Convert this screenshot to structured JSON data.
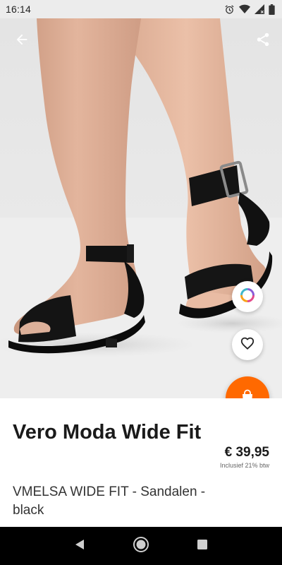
{
  "status_bar": {
    "time": "16:14",
    "icons": [
      "alarm-icon",
      "wifi-icon",
      "signal-icon",
      "battery-icon"
    ]
  },
  "header": {
    "back_icon": "arrow-left-icon",
    "share_icon": "share-icon"
  },
  "actions": {
    "color_icon": "color-ring-icon",
    "wishlist_icon": "heart-outline-icon",
    "cart_icon": "shopping-bag-icon",
    "cart_color": "#ff6900"
  },
  "product": {
    "brand_name": "Vero Moda Wide Fit",
    "price": "€ 39,95",
    "vat_note": "Inclusief 21% btw",
    "name": "VMELSA WIDE FIT  - Sandalen - black"
  },
  "navigation": {
    "back_icon": "nav-back-icon",
    "home_icon": "nav-home-icon",
    "recents_icon": "nav-recents-icon"
  }
}
